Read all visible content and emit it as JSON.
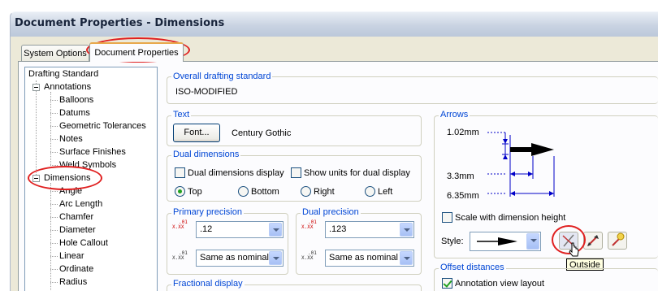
{
  "window": {
    "title": "Document Properties - Dimensions"
  },
  "tabs": [
    {
      "label": "System Options"
    },
    {
      "label": "Document Properties"
    }
  ],
  "tree": {
    "root": "Drafting Standard",
    "annotations": {
      "label": "Annotations",
      "children": [
        "Balloons",
        "Datums",
        "Geometric Tolerances",
        "Notes",
        "Surface Finishes",
        "Weld Symbols"
      ]
    },
    "dimensions": {
      "label": "Dimensions",
      "children": [
        "Angle",
        "Arc Length",
        "Chamfer",
        "Diameter",
        "Hole Callout",
        "Linear",
        "Ordinate",
        "Radius"
      ]
    }
  },
  "overall_standard": {
    "label": "Overall drafting standard",
    "value": "ISO-MODIFIED"
  },
  "text_group": {
    "label": "Text",
    "font_button": "Font...",
    "font_name": "Century Gothic"
  },
  "dual_dimensions": {
    "label": "Dual dimensions",
    "display_label": "Dual dimensions display",
    "display_checked": false,
    "show_units_label": "Show units for dual display",
    "show_units_checked": false,
    "positions": [
      {
        "label": "Top",
        "selected": true
      },
      {
        "label": "Bottom",
        "selected": false
      },
      {
        "label": "Right",
        "selected": false
      },
      {
        "label": "Left",
        "selected": false
      }
    ]
  },
  "primary_precision": {
    "label": "Primary precision",
    "value": ".12",
    "tolerance": "Same as nominal"
  },
  "dual_precision": {
    "label": "Dual precision",
    "value": ".123",
    "tolerance": "Same as nominal"
  },
  "precision_icon_text": {
    "a": ".01",
    "b": "X.XX"
  },
  "fractional_display": {
    "label": "Fractional display"
  },
  "arrows": {
    "label": "Arrows",
    "dims": [
      "1.02mm",
      "3.3mm",
      "6.35mm"
    ],
    "scale_label": "Scale with dimension height",
    "scale_checked": false,
    "style_label": "Style:",
    "tooltip": "Outside"
  },
  "offset": {
    "label": "Offset distances",
    "annotation_view_label": "Annotation view layout",
    "annotation_view_checked": true
  },
  "colors": {
    "highlight": "#e02020",
    "group_label": "#0046d5",
    "checkmark": "#21a121"
  }
}
